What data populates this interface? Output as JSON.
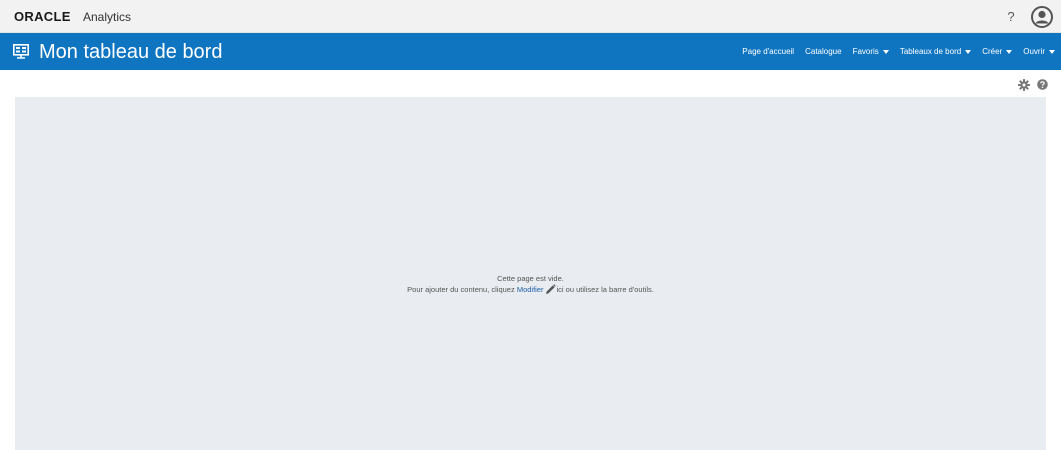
{
  "brand": {
    "logo": "ORACLE",
    "product": "Analytics",
    "help_label": "?"
  },
  "header": {
    "title": "Mon tableau de bord",
    "nav": [
      {
        "label": "Page d'accueil",
        "dropdown": false
      },
      {
        "label": "Catalogue",
        "dropdown": false
      },
      {
        "label": "Favoris",
        "dropdown": true
      },
      {
        "label": "Tableaux de bord",
        "dropdown": true
      },
      {
        "label": "Créer",
        "dropdown": true
      },
      {
        "label": "Ouvrir",
        "dropdown": true
      }
    ]
  },
  "toolbar": {
    "icons": [
      "gear-icon",
      "help-icon"
    ]
  },
  "empty_state": {
    "line1": "Cette page est vide.",
    "line2_prefix": "Pour ajouter du contenu, cliquez",
    "edit_link": "Modifier",
    "line2_suffix": "ici ou utilisez la barre d'outils."
  },
  "colors": {
    "header_bg": "#0f75c1",
    "brand_bar_bg": "#f2f2f2",
    "content_bg": "#e9ecf0",
    "link": "#1e5fa8"
  }
}
